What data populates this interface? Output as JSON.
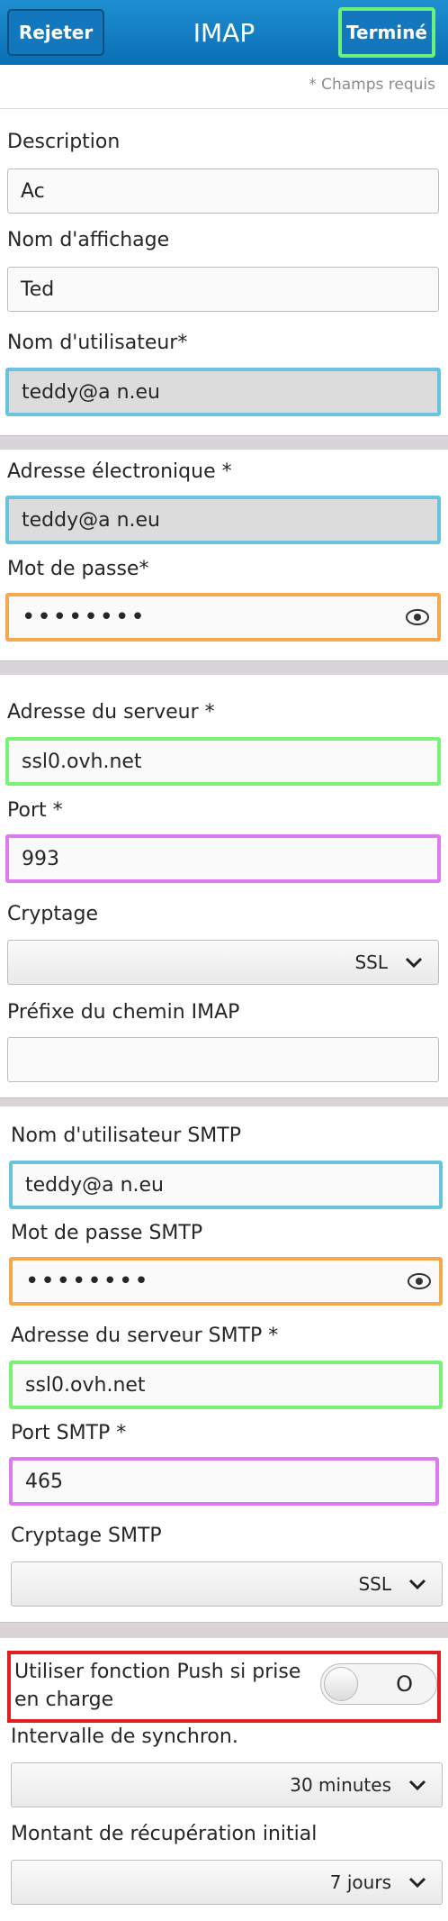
{
  "header": {
    "reject_label": "Rejeter",
    "title": "IMAP",
    "done_label": "Terminé"
  },
  "required_note": "* Champs requis",
  "account": {
    "description_label": "Description",
    "description_value": "Ac",
    "display_name_label": "Nom d'affichage",
    "display_name_value": "Ted",
    "username_label": "Nom d'utilisateur*",
    "username_value": "teddy@a        n.eu"
  },
  "email": {
    "address_label": "Adresse électronique *",
    "address_value": "teddy@a        n.eu",
    "password_label": "Mot de passe*",
    "password_value": "••••••••"
  },
  "imap": {
    "server_label": "Adresse du serveur *",
    "server_value": "ssl0.ovh.net",
    "port_label": "Port *",
    "port_value": "993",
    "encryption_label": "Cryptage",
    "encryption_value": "SSL",
    "prefix_label": "Préfixe du chemin IMAP",
    "prefix_value": ""
  },
  "smtp": {
    "username_label": "Nom d'utilisateur SMTP",
    "username_value": "teddy@a        n.eu",
    "password_label": "Mot de passe SMTP",
    "password_value": "••••••••",
    "server_label": "Adresse du serveur SMTP *",
    "server_value": "ssl0.ovh.net",
    "port_label": "Port SMTP *",
    "port_value": "465",
    "encryption_label": "Cryptage SMTP",
    "encryption_value": "SSL"
  },
  "sync": {
    "push_label": "Utiliser fonction Push si prise en charge",
    "push_toggle_text": "O",
    "interval_label": "Intervalle de synchron.",
    "interval_value": "30 minutes",
    "initial_label": "Montant de récupération initial",
    "initial_value": "7 jours"
  },
  "icons": {
    "eye": "eye-icon",
    "chevron": "chevron-down-icon"
  },
  "colors": {
    "header": "#0a6fb4",
    "highlight_blue": "#6bc4dd",
    "highlight_orange": "#f5a94f",
    "highlight_green": "#7af27a",
    "highlight_pink": "#dc7af0",
    "highlight_red": "#e02020"
  }
}
